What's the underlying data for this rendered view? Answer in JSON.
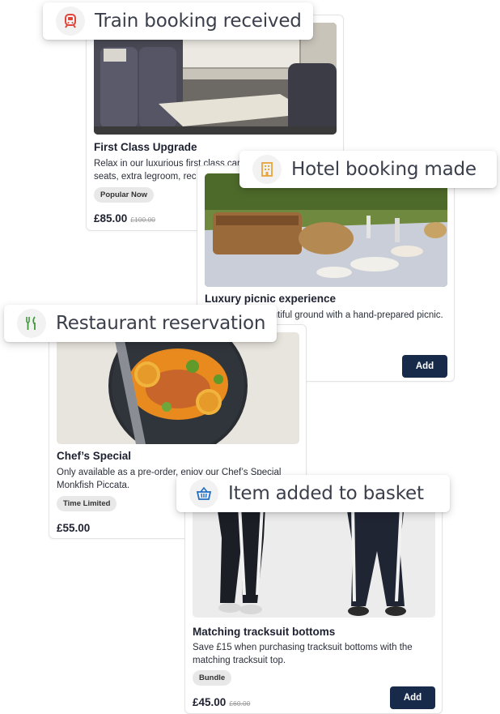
{
  "toasts": {
    "train": "Train booking received",
    "hotel": "Hotel booking made",
    "restaurant": "Restaurant reservation",
    "basket": "Item added to basket"
  },
  "cards": {
    "first_class": {
      "title": "First Class Upgrade",
      "description": "Relax in our luxurious first class carriage with reclining seats, extra legroom, recline and complimentary refreshments.",
      "badge": "Popular Now",
      "price": "£85.00",
      "old_price": "£100.00"
    },
    "picnic": {
      "title": "Luxury picnic experience",
      "description": "Relax in our beautiful ground with a hand-prepared picnic.",
      "add_label": "Add"
    },
    "chefs_special": {
      "title": "Chef’s Special",
      "description": "Only available as a pre-order, enjoy our Chef’s Special Monkfish Piccata.",
      "badge": "Time Limited",
      "price": "£55.00"
    },
    "tracksuit": {
      "title": "Matching tracksuit bottoms",
      "description": "Save £15 when purchasing tracksuit bottoms with the matching tracksuit top.",
      "badge": "Bundle",
      "price": "£45.00",
      "old_price": "£60.00",
      "add_label": "Add"
    }
  },
  "colors": {
    "add_button": "#172a4a",
    "train_icon": "#e0453a",
    "hotel_icon": "#e8a33a",
    "restaurant_icon": "#3e9a3a",
    "basket_icon": "#1f6fc4"
  }
}
